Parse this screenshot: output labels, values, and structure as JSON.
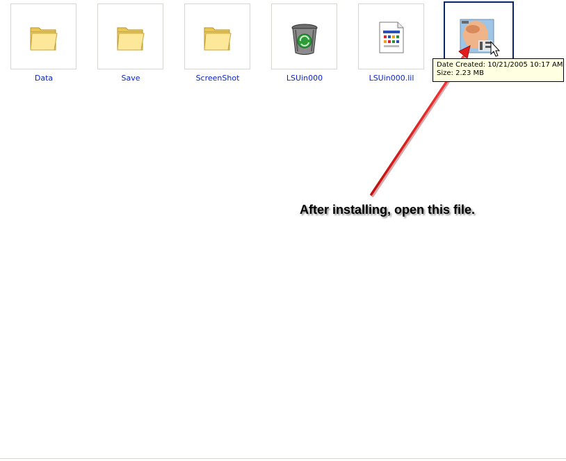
{
  "files": [
    {
      "label": "Data",
      "icon": "folder-icon"
    },
    {
      "label": "Save",
      "icon": "folder-icon"
    },
    {
      "label": "ScreenShot",
      "icon": "folder-icon"
    },
    {
      "label": "LSUin000",
      "icon": "recycle-bin-icon"
    },
    {
      "label": "LSUin000.lil",
      "icon": "document-icon"
    },
    {
      "label": "",
      "icon": "app-thumbnail-icon",
      "selected": true
    }
  ],
  "tooltip": {
    "line1": "Date Created: 10/21/2005 10:17 AM",
    "line2": "Size: 2.23 MB"
  },
  "annotation": {
    "text": "After installing, open this file.",
    "arrow_color": "#e31b1b"
  },
  "colors": {
    "label": "#0b23c9",
    "selection_border": "#0a246a",
    "tooltip_bg": "#ffffe1"
  }
}
